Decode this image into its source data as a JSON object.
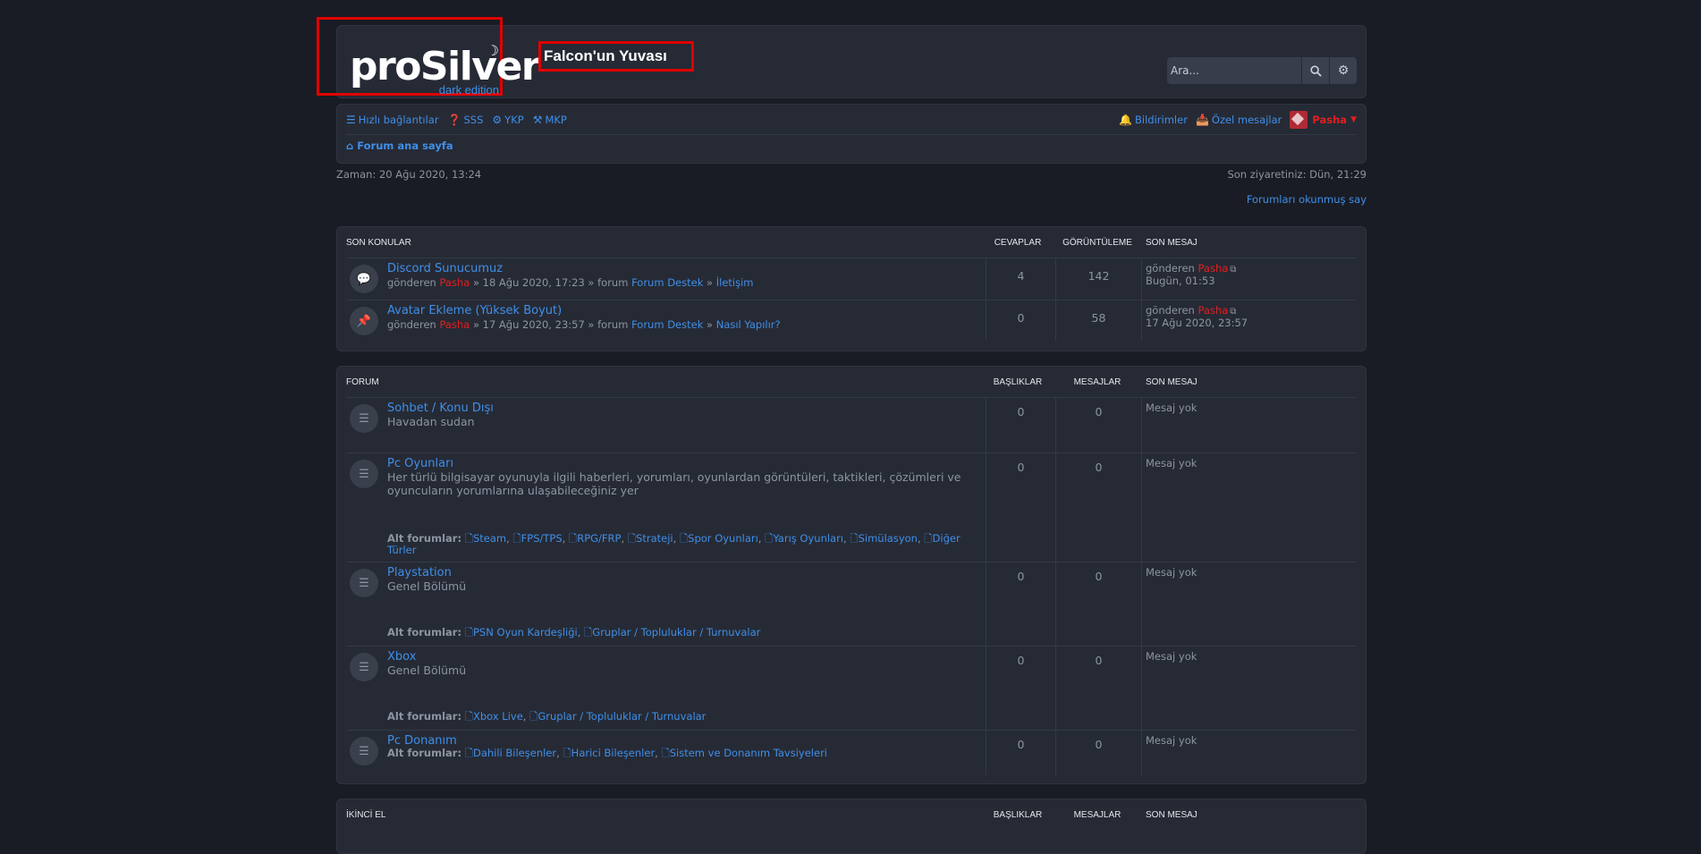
{
  "header": {
    "logo_text": "proSilver",
    "logo_sub": "dark edition",
    "site_name": "Falcon'un Yuvası",
    "search_placeholder": "Ara..."
  },
  "nav": {
    "quick_links": "Hızlı bağlantılar",
    "faq": "SSS",
    "ucp": "YKP",
    "mcp": "MKP",
    "notifications": "Bildirimler",
    "private_messages": "Özel mesajlar",
    "username": "Pasha",
    "forum_index": "Forum ana sayfa"
  },
  "time_now": "Zaman: 20 Ağu 2020, 13:24",
  "last_visit": "Son ziyaretiniz: Dün, 21:29",
  "mark_read": "Forumları okunmuş say",
  "recent": {
    "heading": "SON KONULAR",
    "col_replies": "CEVAPLAR",
    "col_views": "GÖRÜNTÜLEME",
    "col_last": "SON MESAJ",
    "topics": [
      {
        "title": "Discord Sunucumuz",
        "by": "gönderen",
        "author": "Pasha",
        "date": "» 18 Ağu 2020, 17:23 » forum",
        "forum": "Forum Destek",
        "sep": "»",
        "subforum": "İletişim",
        "replies": "4",
        "views": "142",
        "last_by": "gönderen",
        "last_user": "Pasha",
        "last_time": "Bugün, 01:53",
        "icon": "comment-icon"
      },
      {
        "title": "Avatar Ekleme (Yüksek Boyut)",
        "by": "gönderen",
        "author": "Pasha",
        "date": "» 17 Ağu 2020, 23:57 » forum",
        "forum": "Forum Destek",
        "sep": "»",
        "subforum": "Nasıl Yapılır?",
        "replies": "0",
        "views": "58",
        "last_by": "gönderen",
        "last_user": "Pasha",
        "last_time": "17 Ağu 2020, 23:57",
        "icon": "pin-icon"
      }
    ]
  },
  "forum": {
    "heading": "FORUM",
    "col_topics": "BAŞLIKLAR",
    "col_posts": "MESAJLAR",
    "col_last": "SON MESAJ",
    "subforums_label": "Alt forumlar:",
    "no_posts": "Mesaj yok",
    "forums": [
      {
        "title": "Sohbet / Konu Dışı",
        "desc": "Havadan sudan",
        "topics": "0",
        "posts": "0",
        "subforums": []
      },
      {
        "title": "Pc Oyunları",
        "desc": "Her türlü bilgisayar oyunuyla ilgili haberleri, yorumları, oyunlardan görüntüleri, taktikleri, çözümleri ve oyuncuların yorumlarına ulaşabileceğiniz yer",
        "topics": "0",
        "posts": "0",
        "subforums": [
          "Steam",
          "FPS/TPS",
          "RPG/FRP",
          "Strateji",
          "Spor Oyunları",
          "Yarış Oyunları",
          "Simülasyon",
          "Diğer Türler"
        ]
      },
      {
        "title": "Playstation",
        "desc": "Genel Bölümü",
        "topics": "0",
        "posts": "0",
        "subforums": [
          "PSN Oyun Kardeşliği",
          "Gruplar / Topluluklar / Turnuvalar"
        ]
      },
      {
        "title": "Xbox",
        "desc": "Genel Bölümü",
        "topics": "0",
        "posts": "0",
        "subforums": [
          "Xbox Live",
          "Gruplar / Topluluklar / Turnuvalar"
        ]
      },
      {
        "title": "Pc Donanım",
        "desc": "",
        "topics": "0",
        "posts": "0",
        "subforums": [
          "Dahili Bileşenler",
          "Harici Bileşenler",
          "Sistem ve Donanım Tavsiyeleri"
        ]
      }
    ]
  },
  "second_hand": {
    "heading": "İKİNCİ EL",
    "col_topics": "BAŞLIKLAR",
    "col_posts": "MESAJLAR",
    "col_last": "SON MESAJ"
  }
}
